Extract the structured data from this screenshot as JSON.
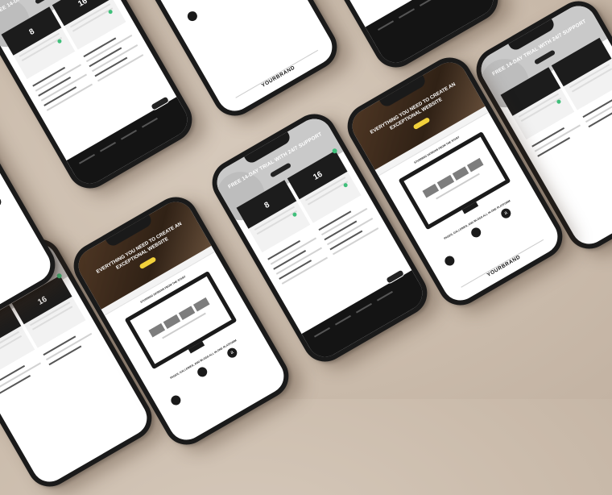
{
  "scene": {
    "background_color": "#cdbfb0",
    "phone_color": "#1a1a1a",
    "accent_green": "#3fbf7a",
    "accent_yellow": "#f2d13b"
  },
  "pricing_screen": {
    "header_title": "FREE 14-DAY TRIAL WITH 24/7 SUPPORT",
    "price_left": "8",
    "price_right": "16"
  },
  "hero_screen": {
    "title": "EVERYTHING YOU NEED TO CREATE AN EXCEPTIONAL WEBSITE",
    "section_title": "STUNNING DESIGNS FROM THE START",
    "integrations_title": "PAGES, GALLERIES, AND BLOGS ALL IN ONE PLATFORM",
    "logo_a": "a",
    "brand_text": "YOURBRAND"
  }
}
